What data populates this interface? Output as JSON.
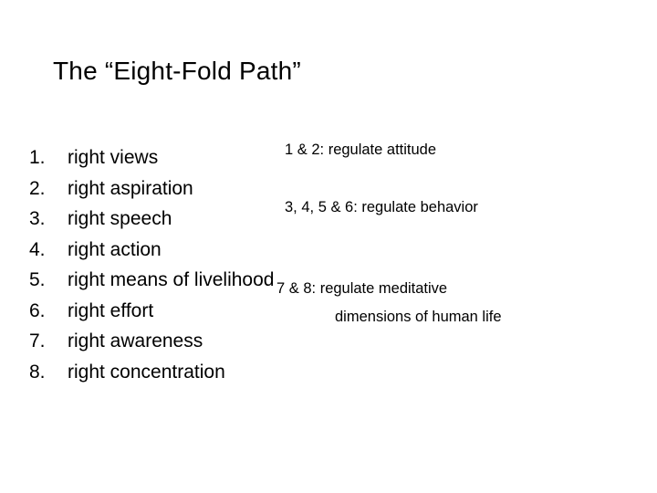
{
  "slide": {
    "title": "The “Eight-Fold Path”",
    "items": [
      {
        "number": "1.",
        "text": "right views"
      },
      {
        "number": "2.",
        "text": "right aspiration"
      },
      {
        "number": "3.",
        "text": "right speech"
      },
      {
        "number": "4.",
        "text": "right action"
      },
      {
        "number": "5.",
        "text": "right means of livelihood"
      },
      {
        "number": "6.",
        "text": "right effort"
      },
      {
        "number": "7.",
        "text": "right awareness"
      },
      {
        "number": "8.",
        "text": "right concentration"
      }
    ],
    "notes": {
      "attitude": "1 & 2: regulate attitude",
      "behavior": "3, 4, 5 & 6: regulate behavior",
      "meditative_line1": "7 & 8: regulate meditative",
      "meditative_line2": "dimensions of human life"
    }
  }
}
